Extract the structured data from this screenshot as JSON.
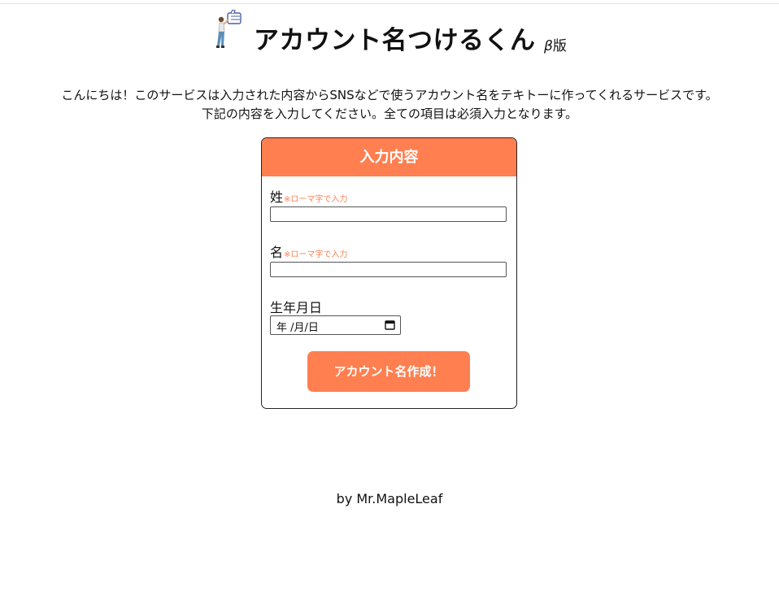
{
  "header": {
    "title": "アカウント名つけるくん",
    "beta_greek": "β",
    "beta_text": "版",
    "mascot_icon": "mascot-thumbs-up-icon"
  },
  "intro": {
    "line1": "こんにちは！このサービスは入力された内容からSNSなどで使うアカウント名をテキトーに作ってくれるサービスです。",
    "line2": "下記の内容を入力してください。全ての項目は必須入力となります。"
  },
  "form": {
    "header": "入力内容",
    "last_name": {
      "label": "姓",
      "note": "※ローマ字で入力",
      "value": ""
    },
    "first_name": {
      "label": "名",
      "note": "※ローマ字で入力",
      "value": ""
    },
    "birthday": {
      "label": "生年月日",
      "placeholder": "年 /月/日",
      "icon": "calendar-icon"
    },
    "submit_label": "アカウント名作成！"
  },
  "footer": {
    "credit": "by Mr.MapleLeaf"
  },
  "colors": {
    "accent": "#ff7f50",
    "text": "#111111",
    "border": "#222222"
  }
}
